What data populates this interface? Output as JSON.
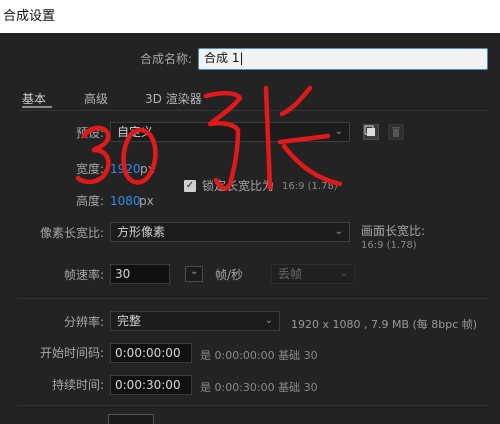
{
  "window": {
    "title": "合成设置"
  },
  "name_row": {
    "label": "合成名称:",
    "value": "合成 1"
  },
  "tabs": [
    {
      "label": "基本"
    },
    {
      "label": "高级"
    },
    {
      "label": "3D 渲染器"
    }
  ],
  "preset": {
    "label": "预设:",
    "value": "自定义"
  },
  "width": {
    "label": "宽度:",
    "value": "1920",
    "unit": "px"
  },
  "height": {
    "label": "高度:",
    "value": "1080",
    "unit": "px"
  },
  "lock_aspect": {
    "label": "锁定长宽比为",
    "ratio": "16:9 (1.78)",
    "checked": true
  },
  "pixel_aspect": {
    "label": "像素长宽比:",
    "value": "方形像素"
  },
  "frame_aspect": {
    "label": "画面长宽比:",
    "value": "16:9 (1.78)"
  },
  "frame_rate": {
    "label": "帧速率:",
    "value": "30",
    "unit": "帧/秒",
    "drop_frame": "丢帧"
  },
  "resolution": {
    "label": "分辨率:",
    "value": "完整",
    "info": "1920 x 1080 , 7.9 MB (每 8bpc 帧)"
  },
  "start_timecode": {
    "label": "开始时间码:",
    "value": "0:00:00:00",
    "is_text": "是 0:00:00:00 基础 30"
  },
  "duration": {
    "label": "持续时间:",
    "value": "0:00:30:00",
    "is_text": "是 0:00:30:00 基础 30"
  },
  "handwriting": {
    "text": "30 张",
    "color": "#e0191b"
  }
}
